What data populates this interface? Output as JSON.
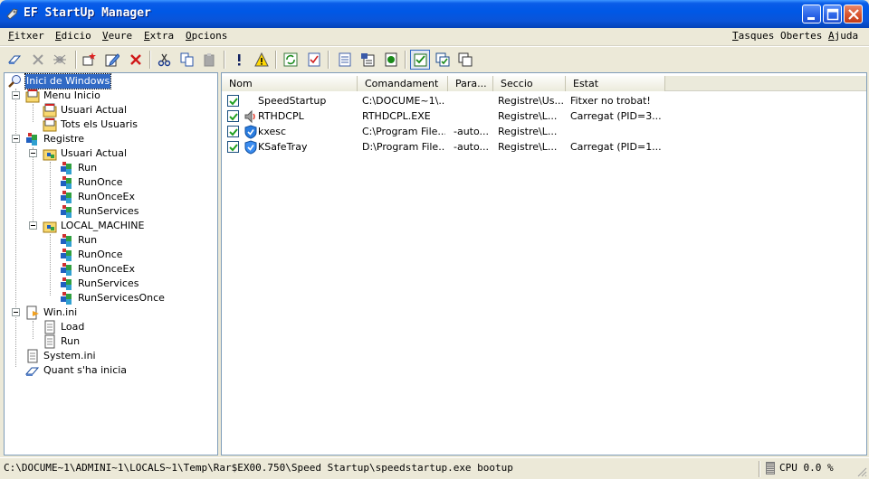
{
  "window": {
    "title": "EF StartUp Manager"
  },
  "menu": {
    "left": [
      "Fitxer",
      "Edicio",
      "Veure",
      "Extra",
      "Opcions"
    ],
    "right": [
      "Tasques Obertes",
      "Ajuda"
    ]
  },
  "tree": {
    "items": [
      {
        "label": "Inici de Windows"
      },
      {
        "label": "Menu Inicio"
      },
      {
        "label": "Usuari Actual"
      },
      {
        "label": "Tots els Usuaris"
      },
      {
        "label": "Registre"
      },
      {
        "label": "Usuari Actual"
      },
      {
        "label": "Run"
      },
      {
        "label": "RunOnce"
      },
      {
        "label": "RunOnceEx"
      },
      {
        "label": "RunServices"
      },
      {
        "label": "LOCAL_MACHINE"
      },
      {
        "label": "Run"
      },
      {
        "label": "RunOnce"
      },
      {
        "label": "RunOnceEx"
      },
      {
        "label": "RunServices"
      },
      {
        "label": "RunServicesOnce"
      },
      {
        "label": "Win.ini"
      },
      {
        "label": "Load"
      },
      {
        "label": "Run"
      },
      {
        "label": "System.ini"
      },
      {
        "label": "Quant s'ha inicia"
      }
    ]
  },
  "list": {
    "columns": [
      "Nom",
      "Comandament",
      "Para...",
      "Seccio",
      "Estat"
    ],
    "rows": [
      {
        "name": "SpeedStartup",
        "command": "C:\\DOCUME~1\\...",
        "params": "",
        "section": "Registre\\Us...",
        "state": "Fitxer no trobat!"
      },
      {
        "name": "RTHDCPL",
        "command": "RTHDCPL.EXE",
        "params": "",
        "section": "Registre\\L...",
        "state": "Carregat (PID=3..."
      },
      {
        "name": "kxesc",
        "command": "C:\\Program File...",
        "params": "-auto...",
        "section": "Registre\\L...",
        "state": ""
      },
      {
        "name": "KSafeTray",
        "command": "D:\\Program File...",
        "params": "-auto...",
        "section": "Registre\\L...",
        "state": "Carregat (PID=1..."
      }
    ]
  },
  "status": {
    "path": "C:\\DOCUME~1\\ADMINI~1\\LOCALS~1\\Temp\\Rar$EX00.750\\Speed Startup\\speedstartup.exe bootup",
    "cpu": "CPU 0.0 %"
  }
}
